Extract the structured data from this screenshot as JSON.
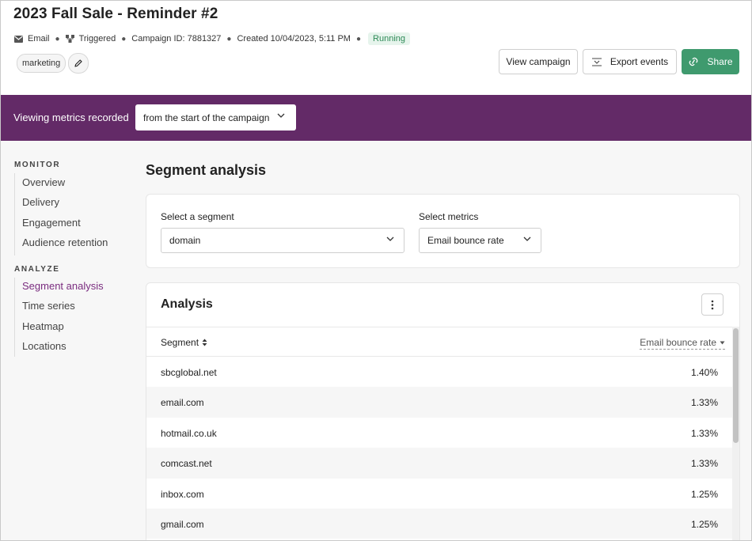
{
  "header": {
    "title": "2023 Fall Sale - Reminder #2",
    "meta": {
      "channel": "Email",
      "trigger": "Triggered",
      "campaign_id": "Campaign ID: 7881327",
      "created": "Created 10/04/2023, 5:11 PM",
      "status": "Running"
    },
    "tag": "marketing",
    "buttons": {
      "view": "View campaign",
      "export": "Export events",
      "share": "Share"
    }
  },
  "metrics_bar": {
    "label": "Viewing metrics recorded",
    "selected": "from the start of the campaign"
  },
  "sidebar": {
    "monitor_heading": "MONITOR",
    "monitor_items": [
      "Overview",
      "Delivery",
      "Engagement",
      "Audience retention"
    ],
    "analyze_heading": "ANALYZE",
    "analyze_items": [
      "Segment analysis",
      "Time series",
      "Heatmap",
      "Locations"
    ],
    "active": "Segment analysis"
  },
  "main": {
    "page_title": "Segment analysis",
    "segment_label": "Select a segment",
    "segment_value": "domain",
    "metrics_label": "Select metrics",
    "metrics_value": "Email bounce rate",
    "analysis_title": "Analysis",
    "table": {
      "columns": [
        "Segment",
        "Email bounce rate"
      ],
      "rows": [
        {
          "segment": "sbcglobal.net",
          "value": "1.40%"
        },
        {
          "segment": "email.com",
          "value": "1.33%"
        },
        {
          "segment": "hotmail.co.uk",
          "value": "1.33%"
        },
        {
          "segment": "comcast.net",
          "value": "1.33%"
        },
        {
          "segment": "inbox.com",
          "value": "1.25%"
        },
        {
          "segment": "gmail.com",
          "value": "1.25%"
        }
      ]
    }
  },
  "colors": {
    "brand_purple": "#632a67",
    "accent_green": "#3f9a6e",
    "status_green": "#2e8a57"
  }
}
